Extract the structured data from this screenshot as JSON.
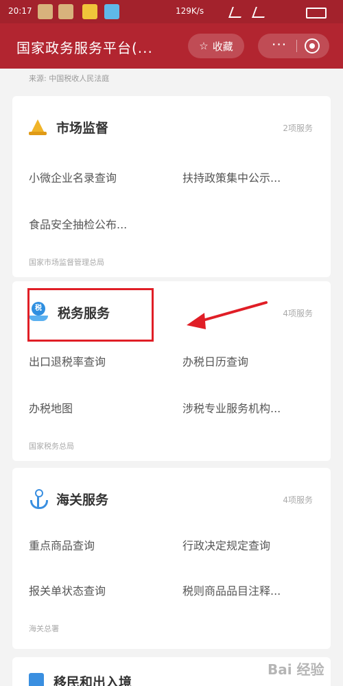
{
  "status_bar": {
    "time": "20:17",
    "speed": "129K/s",
    "battery_pct": "",
    "accent": "#a3222c"
  },
  "header": {
    "title": "国家政务服务平台(...",
    "favorite_label": "收藏",
    "favorite_icon": "star-icon",
    "more_label": "···",
    "accent": "#b22530"
  },
  "top_source": "来源: 中国税收人民法庭",
  "cards": [
    {
      "title": "市场监督",
      "icon": "cone-icon",
      "count": "2项服务",
      "items": [
        "小微企业名录查询",
        "扶持政策集中公示...",
        "食品安全抽检公布..."
      ],
      "source": "国家市场监督管理总局"
    },
    {
      "title": "税务服务",
      "icon": "tax-hand-icon",
      "icon_text": "税",
      "count": "4项服务",
      "items": [
        "出口退税率查询",
        "办税日历查询",
        "办税地图",
        "涉税专业服务机构..."
      ],
      "source": "国家税务总局"
    },
    {
      "title": "海关服务",
      "icon": "anchor-icon",
      "count": "4项服务",
      "items": [
        "重点商品查询",
        "行政决定规定查询",
        "报关单状态查询",
        "税则商品品目注释..."
      ],
      "source": "海关总署"
    },
    {
      "title": "移民和出入境",
      "icon": "document-icon"
    }
  ],
  "annotation": {
    "highlight_color": "#e01e26"
  },
  "watermark": "Bai 经验"
}
